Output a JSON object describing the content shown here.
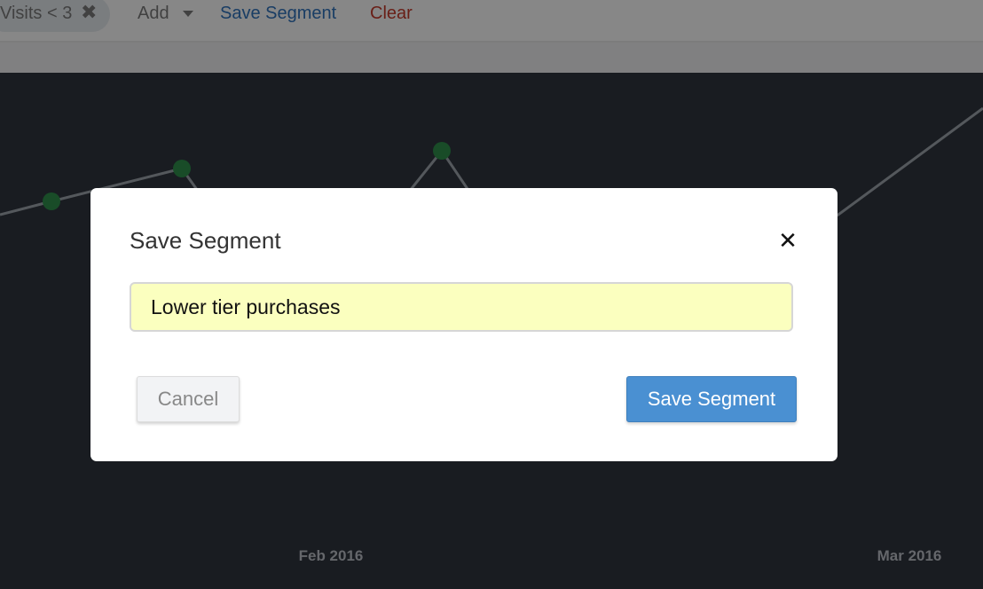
{
  "filter_bar": {
    "pill_label": "Visits < 3",
    "pill_remove_icon": "close-icon",
    "add_label": "Add",
    "add_caret_icon": "caret-down-icon",
    "save_segment_label": "Save Segment",
    "clear_label": "Clear"
  },
  "chart_data": {
    "type": "line",
    "x_tick_labels": [
      "Feb 2016",
      "Mar 2016"
    ],
    "line_color": "#9aa0a8",
    "point_color": "#2e8b4a",
    "grid": false
  },
  "modal": {
    "title": "Save Segment",
    "close_icon": "close-icon",
    "input_value": "Lower tier purchases",
    "cancel_label": "Cancel",
    "save_label": "Save Segment"
  },
  "colors": {
    "primary_button": "#4a90d2",
    "input_highlight": "#fbffbf",
    "link_blue": "#2f6fb7",
    "link_red": "#c0392b"
  }
}
